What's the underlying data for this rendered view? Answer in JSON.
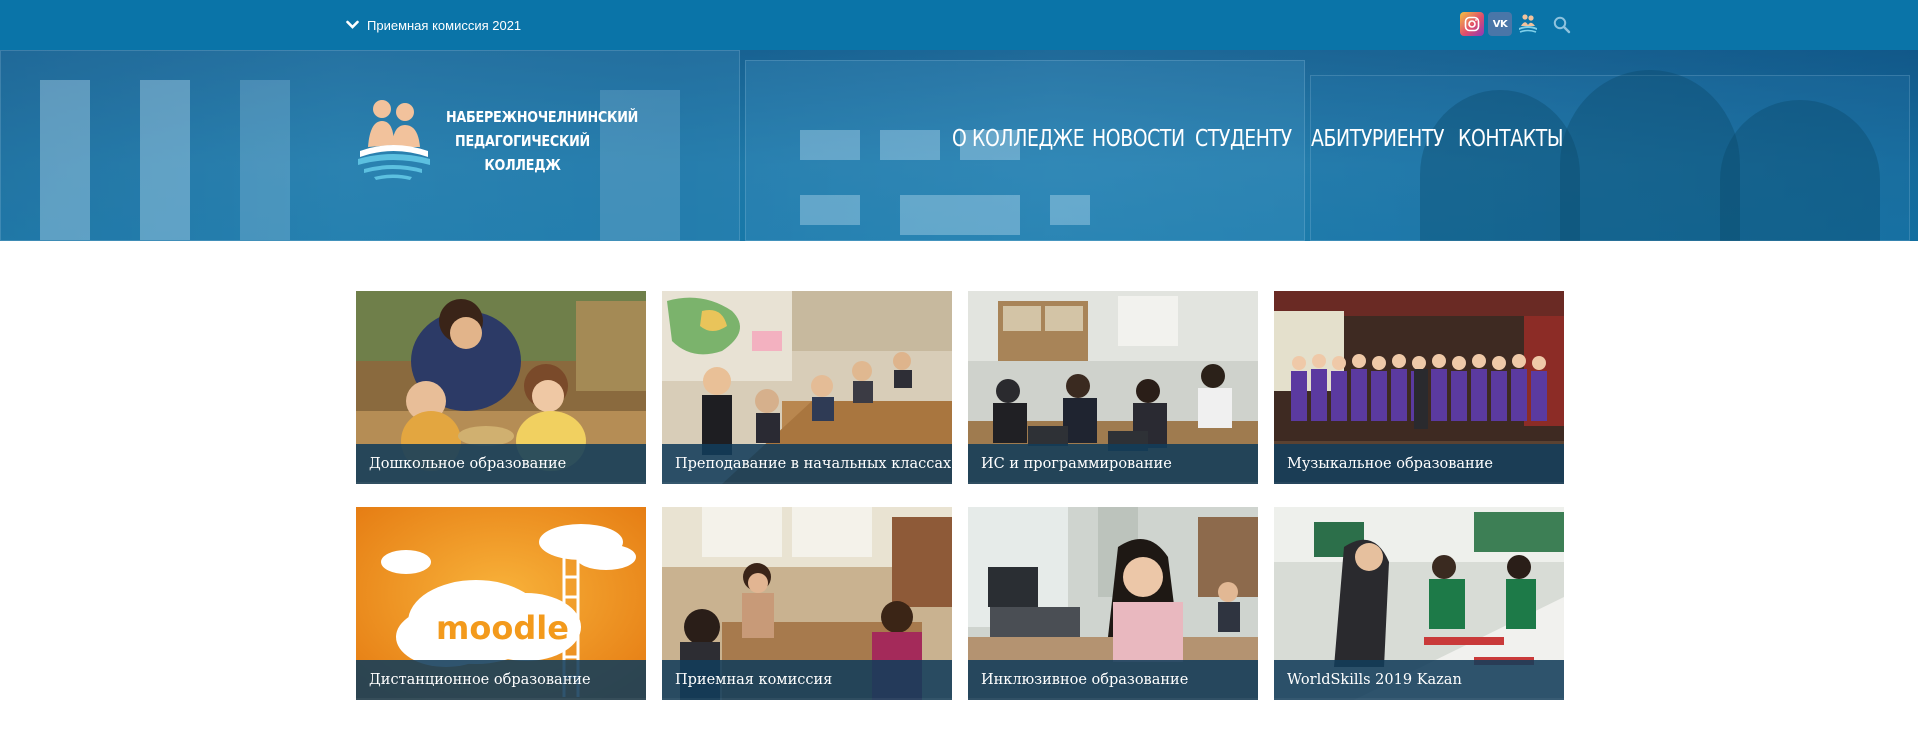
{
  "topbar": {
    "menu_label": "Приемная комиссия 2021",
    "icons": [
      "instagram-icon",
      "vk-icon",
      "college-logo-icon",
      "search-icon"
    ],
    "vk_text": "VK",
    "background": "#0a74a8"
  },
  "header": {
    "brand_lines": [
      "НАБЕРЕЖНОЧЕЛНИНСКИЙ",
      "ПЕДАГОГИЧЕСКИЙ",
      "КОЛЛЕДЖ"
    ],
    "nav": [
      {
        "label": "О КОЛЛЕДЖЕ"
      },
      {
        "label": "НОВОСТИ"
      },
      {
        "label": "СТУДЕНТУ"
      },
      {
        "label": "АБИТУРИЕНТУ"
      },
      {
        "label": "КОНТАКТЫ"
      }
    ]
  },
  "tiles": [
    {
      "caption": "Дошкольное образование"
    },
    {
      "caption": "Преподавание в начальных классах"
    },
    {
      "caption": "ИС и программирование"
    },
    {
      "caption": "Музыкальное образование"
    },
    {
      "caption": "Дистанционное образование"
    },
    {
      "caption": "Приемная комиссия"
    },
    {
      "caption": "Инклюзивное образование"
    },
    {
      "caption": "WorldSkills 2019 Kazan"
    }
  ],
  "moodle_text": "moodle",
  "colors": {
    "accent": "#0a74a8",
    "caption_bg": "#123c5a",
    "moodle_orange": "#f39a1c"
  }
}
